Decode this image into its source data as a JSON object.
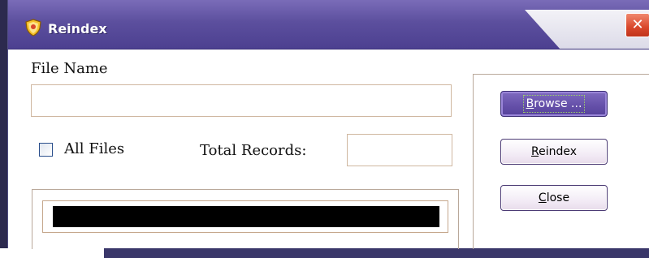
{
  "window": {
    "title": "Reindex",
    "close_glyph": "✕"
  },
  "form": {
    "file_name_label": "File Name",
    "file_name_value": "",
    "all_files_label": "All Files",
    "all_files_checked": false,
    "total_records_label": "Total Records:",
    "total_records_value": ""
  },
  "progress": {
    "fraction": 1.0,
    "color": "#000000"
  },
  "buttons": {
    "browse": {
      "accel": "B",
      "rest": "rowse ..."
    },
    "reindex": {
      "accel": "R",
      "rest": "eindex"
    },
    "close": {
      "accel": "C",
      "rest": "lose"
    }
  },
  "colors": {
    "title_bar": "#5c4f9e",
    "close_button": "#d9472b",
    "primary_button": "#6651aa"
  },
  "icons": {
    "app": "shield-icon",
    "close": "close-icon"
  }
}
